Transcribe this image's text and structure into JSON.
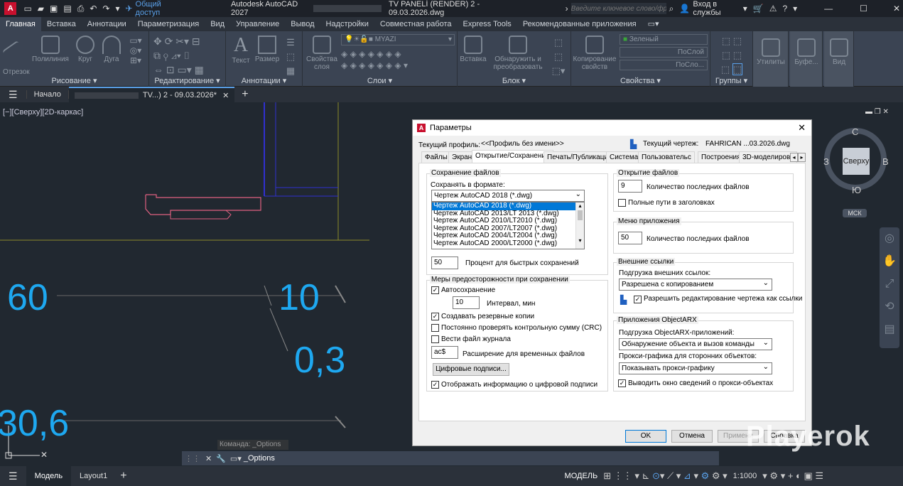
{
  "app": {
    "title": "Autodesk AutoCAD 2027",
    "file": "TV PANELİ (RENDER) 2 - 09.03.2026.dwg",
    "share": "Общий доступ",
    "search_placeholder": "Введите ключевое слово/фразу",
    "login": "Вход в службы"
  },
  "ribbon_tabs": [
    "Главная",
    "Вставка",
    "Аннотации",
    "Параметризация",
    "Вид",
    "Управление",
    "Вывод",
    "Надстройки",
    "Совместная работа",
    "Express Tools",
    "Рекомендованные приложения"
  ],
  "panels": {
    "draw": "Рисование",
    "modify": "Редактирование",
    "annot": "Аннотации",
    "layers": "Слои",
    "block": "Блок",
    "props": "Свойства",
    "groups": "Группы"
  },
  "tools": {
    "line": "Отрезок",
    "pline": "Полилиния",
    "circle": "Круг",
    "arc": "Дуга",
    "text": "Текст",
    "dim": "Размер",
    "layerprops": "Свойства слоя",
    "insert": "Вставка",
    "detect": "Обнаружить и преобразовать",
    "copyprops": "Копирование свойств",
    "util": "Утилиты",
    "buffer": "Буфе...",
    "view": "Вид",
    "layer": "MYAZI",
    "color": "Зеленый",
    "bylayer1": "ПоСлой",
    "bylayer2": "ПоСло..."
  },
  "doctabs": {
    "start": "Начало",
    "current": "TV...) 2 - 09.03.2026*"
  },
  "viewport": {
    "label": "[−][Сверху][2D-каркас]",
    "cube_top": "Сверху",
    "n": "С",
    "s": "Ю",
    "w": "З",
    "e": "В",
    "ucs": "МСК"
  },
  "dims": {
    "d1": "60",
    "d2": "10",
    "d3": "0,3",
    "d4": "30,6"
  },
  "command": {
    "history": "Команда: _Options",
    "current": "_Options"
  },
  "status": {
    "model_tab": "Модель",
    "layout": "Layout1",
    "model": "МОДЕЛЬ",
    "scale": "1:1000"
  },
  "dialog": {
    "title": "Параметры",
    "profile_label": "Текущий профиль:",
    "profile": "<<Профиль без имени>>",
    "drawing_label": "Текущий чертеж:",
    "drawing": "FAHRICAN ...03.2026.dwg",
    "tabs": [
      "Файлы",
      "Экран",
      "Открытие/Сохранение",
      "Печать/Публикация",
      "Система",
      "Пользовательс",
      "Построения",
      "3D-моделирова"
    ],
    "save_group": "Сохранение файлов",
    "save_as_label": "Сохранять в формате:",
    "save_as": "Чертеж AutoCAD 2018 (*.dwg)",
    "formats": [
      "Чертеж AutoCAD 2018 (*.dwg)",
      "Чертеж AutoCAD 2013/LT 2013 (*.dwg)",
      "Чертеж AutoCAD 2010/LT2010 (*.dwg)",
      "Чертеж AutoCAD 2007/LT2007 (*.dwg)",
      "Чертеж AutoCAD 2004/LT2004 (*.dwg)",
      "Чертеж AutoCAD 2000/LT2000 (*.dwg)"
    ],
    "incr_value": "50",
    "incr_label": "Процент для быстрых сохранений",
    "safety_group": "Меры предосторожности при сохранении",
    "autosave": "Автосохранение",
    "interval_value": "10",
    "interval_label": "Интервал, мин",
    "backup": "Создавать резервные копии",
    "crc": "Постоянно проверять контрольную сумму (CRC)",
    "log": "Вести файл журнала",
    "ext_value": "ac$",
    "ext_label": "Расширение для временных файлов",
    "digsig_btn": "Цифровые подписи...",
    "digsig_info": "Отображать информацию о цифровой подписи",
    "open_group": "Открытие файлов",
    "recent_value": "9",
    "recent_label": "Количество последних файлов",
    "fullpath": "Полные пути в заголовках",
    "menu_group": "Меню приложения",
    "menu_value": "50",
    "menu_label": "Количество последних файлов",
    "xref_group": "Внешние ссылки",
    "xref_load_label": "Подгрузка внешних ссылок:",
    "xref_load": "Разрешена с копированием",
    "xref_edit": "Разрешить редактирование чертежа как ссылки",
    "arx_group": "Приложения ObjectARX",
    "arx_load_label": "Подгрузка ObjectARX-приложений:",
    "arx_load": "Обнаружение объекта и вызов команды",
    "proxy_label": "Прокси-графика для сторонних объектов:",
    "proxy": "Показывать прокси-графику",
    "proxy_info": "Выводить окно сведений о прокси-объектах",
    "ok": "OK",
    "cancel": "Отмена",
    "apply": "Примени",
    "help": "Справка"
  },
  "watermark": "Playerok"
}
